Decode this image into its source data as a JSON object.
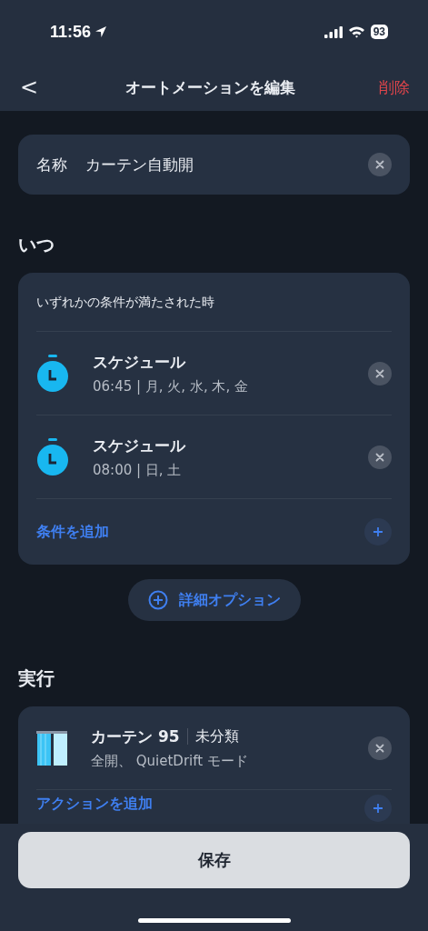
{
  "status_bar": {
    "time": "11:56",
    "battery": "93"
  },
  "nav": {
    "back": "<",
    "title": "オートメーションを編集",
    "delete": "削除"
  },
  "name_field": {
    "label": "名称",
    "value": "カーテン自動開"
  },
  "when": {
    "heading": "いつ",
    "subtitle": "いずれかの条件が満たされた時",
    "conditions": [
      {
        "title": "スケジュール",
        "detail": "06:45 | 月, 火, 水, 木, 金"
      },
      {
        "title": "スケジュール",
        "detail": "08:00 | 日, 土"
      }
    ],
    "add_label": "条件を追加"
  },
  "advanced_button": "詳細オプション",
  "run": {
    "heading": "実行",
    "actions": [
      {
        "device": "カーテン 95",
        "category": "未分類",
        "detail": "全開、 QuietDrift モード"
      }
    ],
    "add_label": "アクションを追加"
  },
  "save_button": "保存"
}
